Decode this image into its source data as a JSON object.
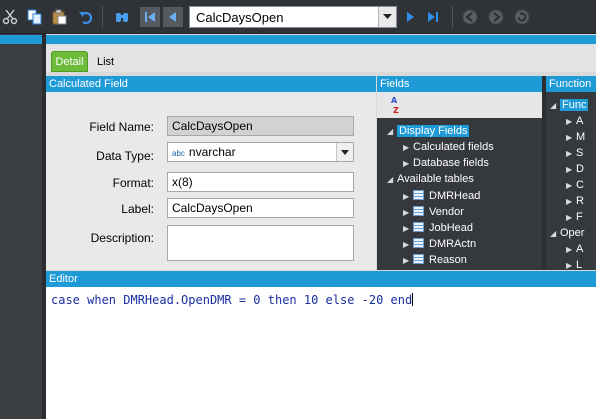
{
  "toolbar": {
    "icons": [
      "cut-icon",
      "copy-icon",
      "paste-icon",
      "undo-icon",
      "find-icon",
      "first-record-icon",
      "previous-record-icon",
      "next-record-icon",
      "last-record-icon",
      "back-icon",
      "forward-icon",
      "refresh-icon"
    ],
    "record_combo": "CalcDaysOpen"
  },
  "tabs": {
    "detail": "Detail",
    "list": "List"
  },
  "calc_panel": {
    "title": "Calculated Field",
    "field_name_label": "Field Name:",
    "field_name_value": "CalcDaysOpen",
    "data_type_label": "Data Type:",
    "data_type_prefix": "abc",
    "data_type_value": "nvarchar",
    "format_label": "Format:",
    "format_value": "x(8)",
    "label_label": "Label:",
    "label_value": "CalcDaysOpen",
    "description_label": "Description:",
    "description_value": ""
  },
  "fields_panel": {
    "title": "Fields",
    "display_fields": "Display Fields",
    "calculated_fields": "Calculated fields",
    "database_fields": "Database fields",
    "available_tables": "Available tables",
    "tables": [
      "DMRHead",
      "Vendor",
      "JobHead",
      "DMRActn",
      "Reason"
    ]
  },
  "functions_panel": {
    "title": "Function",
    "group1": "Func",
    "items": [
      "A",
      "M",
      "S",
      "D",
      "C",
      "R",
      "F"
    ],
    "group2": "Oper",
    "items2": [
      "A",
      "L"
    ]
  },
  "editor": {
    "title": "Editor",
    "code": "case when DMRHead.OpenDMR = 0 then 10 else -20 end"
  },
  "colors": {
    "accent": "#1e9bd6",
    "tab_active": "#6dbb3a",
    "selection": "#1e9bd6"
  }
}
